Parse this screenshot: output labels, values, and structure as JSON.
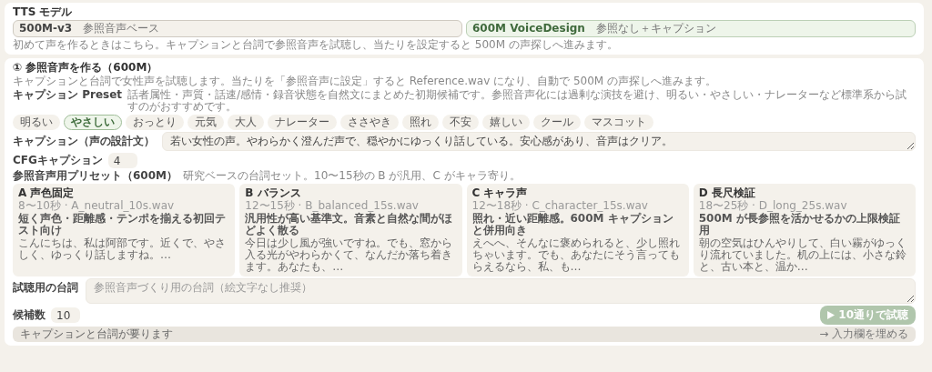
{
  "model_section": {
    "title": "TTS モデル",
    "options": [
      {
        "name": "500M-v3",
        "subtitle": "参照音声ベース",
        "selected": false
      },
      {
        "name": "600M VoiceDesign",
        "subtitle": "参照なし＋キャプション",
        "selected": true
      }
    ],
    "note": "初めて声を作るときはこちら。キャプションと台詞で参照音声を試聴し、当たりを設定すると 500M の声探しへ進みます。"
  },
  "reference_section": {
    "title": "① 参照音声を作る（600M）",
    "description": "キャプションと台詞で女性声を試聴します。当たりを「参照音声に設定」すると Reference.wav になり、自動で 500M の声探しへ進みます。",
    "caption_preset": {
      "label": "キャプション Preset",
      "description": "話者属性・声質・話速/感情・録音状態を自然文にまとめた初期候補です。参照音声化には過剰な演技を避け、明るい・やさしい・ナレーターなど標準系から試すのがおすすめです。",
      "chips": [
        {
          "label": "明るい",
          "selected": false
        },
        {
          "label": "やさしい",
          "selected": true
        },
        {
          "label": "おっとり",
          "selected": false
        },
        {
          "label": "元気",
          "selected": false
        },
        {
          "label": "大人",
          "selected": false
        },
        {
          "label": "ナレーター",
          "selected": false
        },
        {
          "label": "ささやき",
          "selected": false
        },
        {
          "label": "照れ",
          "selected": false
        },
        {
          "label": "不安",
          "selected": false
        },
        {
          "label": "嬉しい",
          "selected": false
        },
        {
          "label": "クール",
          "selected": false
        },
        {
          "label": "マスコット",
          "selected": false
        }
      ]
    },
    "caption": {
      "label": "キャプション（声の設計文）",
      "value": "若い女性の声。やわらかく澄んだ声で、穏やかにゆっくり話している。安心感があり、音声はクリア。"
    },
    "cfg": {
      "label": "CFGキャプション",
      "value": "4"
    },
    "script_presets": {
      "label": "参照音声用プリセット（600M）",
      "description": "研究ベースの台詞セット。10〜15秒の B が汎用、C がキャラ寄り。",
      "items": [
        {
          "title": "A 声色固定",
          "meta": "8〜10秒 · A_neutral_10s.wav",
          "purpose": "短く声色・距離感・テンポを揃える初回テスト向け",
          "sample": "こんにちは、私は阿部です。近くで、やさしく、ゆっくり話しますね。…"
        },
        {
          "title": "B バランス",
          "meta": "12〜15秒 · B_balanced_15s.wav",
          "purpose": "汎用性が高い基準文。音素と自然な間がほどよく散る",
          "sample": "今日は少し風が強いですね。でも、窓から入る光がやわらかくて、なんだか落ち着きます。あなたも、…"
        },
        {
          "title": "C キャラ声",
          "meta": "12〜18秒 · C_character_15s.wav",
          "purpose": "照れ・近い距離感。600M キャプションと併用向き",
          "sample": "えへへ、そんなに褒められると、少し照れちゃいます。でも、あなたにそう言ってもらえるなら、私、も…"
        },
        {
          "title": "D 長尺検証",
          "meta": "18〜25秒 · D_long_25s.wav",
          "purpose": "500M が長参照を活かせるかの上限検証用",
          "sample": "朝の空気はひんやりして、白い霧がゆっくり流れていました。机の上には、小さな鈴と、古い本と、温か…"
        }
      ]
    },
    "test_script": {
      "label": "試聴用の台詞",
      "placeholder": "参照音声づくり用の台詞（絵文字なし推奨）"
    },
    "candidates": {
      "label": "候補数",
      "value": "10"
    },
    "run_button": {
      "label": "10通りで試聴",
      "disabled": true
    },
    "status": {
      "message": "キャプションと台詞が要ります",
      "hint": "→ 入力欄を埋める"
    }
  }
}
